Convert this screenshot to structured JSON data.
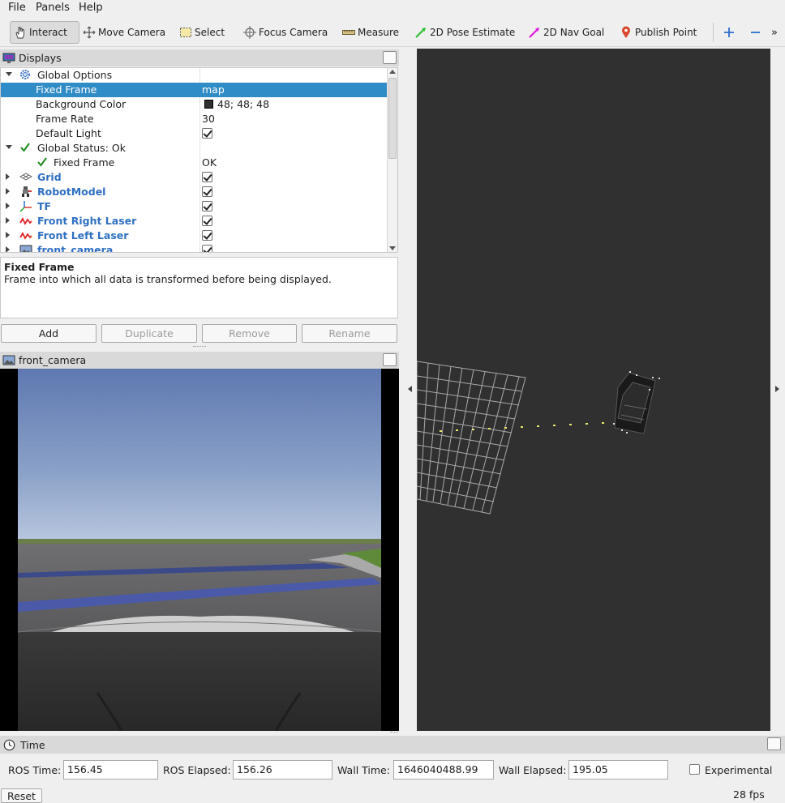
{
  "menu": [
    "File",
    "Panels",
    "Help"
  ],
  "toolbar": {
    "interact": "Interact",
    "move_camera": "Move Camera",
    "select": "Select",
    "focus_camera": "Focus Camera",
    "measure": "Measure",
    "pose_estimate": "2D Pose Estimate",
    "nav_goal": "2D Nav Goal",
    "publish_point": "Publish Point"
  },
  "displays": {
    "title": "Displays",
    "rows": [
      {
        "label": "Global Options",
        "value": ""
      },
      {
        "label": "Fixed Frame",
        "value": "map"
      },
      {
        "label": "Background Color",
        "value": "48; 48; 48"
      },
      {
        "label": "Frame Rate",
        "value": "30"
      },
      {
        "label": "Default Light",
        "value": ""
      },
      {
        "label": "Global Status: Ok",
        "value": ""
      },
      {
        "label": "Fixed Frame",
        "value": "OK"
      },
      {
        "label": "Grid",
        "value": ""
      },
      {
        "label": "RobotModel",
        "value": ""
      },
      {
        "label": "TF",
        "value": ""
      },
      {
        "label": "Front Right Laser",
        "value": ""
      },
      {
        "label": "Front Left Laser",
        "value": ""
      },
      {
        "label": "front_camera",
        "value": ""
      }
    ]
  },
  "description": {
    "title": "Fixed Frame",
    "body": "Frame into which all data is transformed before being displayed."
  },
  "buttons": {
    "add": "Add",
    "duplicate": "Duplicate",
    "remove": "Remove",
    "rename": "Rename"
  },
  "camera_panel": {
    "title": "front_camera"
  },
  "time": {
    "title": "Time",
    "ros_time_label": "ROS Time:",
    "ros_time": "156.45",
    "ros_elapsed_label": "ROS Elapsed:",
    "ros_elapsed": "156.26",
    "wall_time_label": "Wall Time:",
    "wall_time": "1646040488.99",
    "wall_elapsed_label": "Wall Elapsed:",
    "wall_elapsed": "195.05",
    "experimental": "Experimental",
    "reset": "Reset",
    "fps": "28 fps"
  },
  "colors": {
    "selection": "#308cc6",
    "background_3d": "#303030",
    "display_name": "#2f6fc2"
  }
}
